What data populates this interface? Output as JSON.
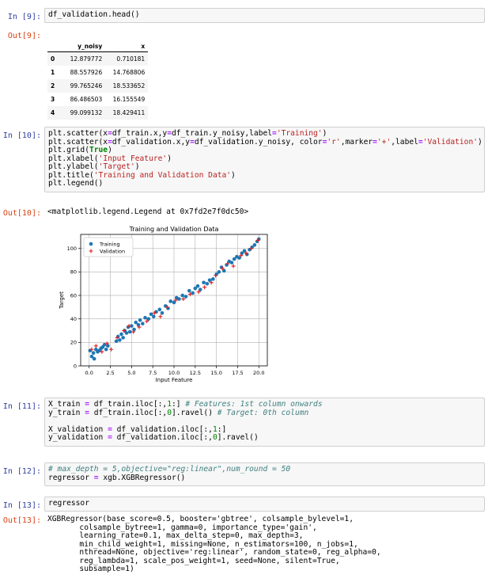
{
  "cells": [
    {
      "in_prompt": "In [9]:",
      "out_prompt": "Out[9]:",
      "code_lines": [
        "df_validation.head()"
      ]
    },
    {
      "in_prompt": "In [10]:",
      "out_prompt": "Out[10]:",
      "output_text": "<matplotlib.legend.Legend at 0x7fd2e7f0dc50>"
    },
    {
      "in_prompt": "In [11]:"
    },
    {
      "in_prompt": "In [12]:"
    },
    {
      "in_prompt": "In [13]:",
      "out_prompt": "Out[13]:"
    }
  ],
  "dataframe": {
    "columns": [
      "y_noisy",
      "x"
    ],
    "rows": [
      {
        "index": "0",
        "y_noisy": "12.879772",
        "x": "0.710181"
      },
      {
        "index": "1",
        "y_noisy": "88.557926",
        "x": "14.768806"
      },
      {
        "index": "2",
        "y_noisy": "99.765246",
        "x": "18.533652"
      },
      {
        "index": "3",
        "y_noisy": "86.486503",
        "x": "16.155549"
      },
      {
        "index": "4",
        "y_noisy": "99.099132",
        "x": "18.429411"
      }
    ]
  },
  "code10": [
    "plt.scatter(x=df_train.x,y=df_train.y_noisy,label='Training')",
    "plt.scatter(x=df_validation.x,y=df_validation.y_noisy, color='r',marker='+',label='Validation')",
    "plt.grid(True)",
    "plt.xlabel('Input Feature')",
    "plt.ylabel('Target')",
    "plt.title('Training and Validation Data')",
    "plt.legend()"
  ],
  "code11": [
    "X_train = df_train.iloc[:,1:] # Features: 1st column onwards",
    "y_train = df_train.iloc[:,0].ravel() # Target: 0th column",
    "",
    "X_validation = df_validation.iloc[:,1:]",
    "y_validation = df_validation.iloc[:,0].ravel()"
  ],
  "code12": [
    "# max_depth = 5,objective=\"reg:linear\",num_round = 50",
    "regressor = xgb.XGBRegressor()"
  ],
  "code13": [
    "regressor"
  ],
  "output13": "XGBRegressor(base_score=0.5, booster='gbtree', colsample_bylevel=1,\n       colsample_bytree=1, gamma=0, importance_type='gain',\n       learning_rate=0.1, max_delta_step=0, max_depth=3,\n       min_child_weight=1, missing=None, n_estimators=100, n_jobs=1,\n       nthread=None, objective='reg:linear', random_state=0, reg_alpha=0,\n       reg_lambda=1, scale_pos_weight=1, seed=None, silent=True,\n       subsample=1)",
  "chart_data": {
    "type": "scatter",
    "title": "Training and Validation Data",
    "xlabel": "Input Feature",
    "ylabel": "Target",
    "xlim": [
      -1,
      21
    ],
    "ylim": [
      0,
      112
    ],
    "xticks": [
      "0.0",
      "2.5",
      "5.0",
      "7.5",
      "10.0",
      "12.5",
      "15.0",
      "17.5",
      "20.0"
    ],
    "xtick_values": [
      0,
      2.5,
      5,
      7.5,
      10,
      12.5,
      15,
      17.5,
      20
    ],
    "yticks": [
      "0",
      "20",
      "40",
      "60",
      "80",
      "100"
    ],
    "ytick_values": [
      0,
      20,
      40,
      60,
      80,
      100
    ],
    "grid": true,
    "legend_position": "upper-left",
    "series": [
      {
        "name": "Training",
        "color": "#1f77b4",
        "marker": "o",
        "x": [
          0.1,
          0.3,
          0.5,
          0.6,
          0.8,
          1.0,
          1.2,
          1.4,
          1.6,
          1.8,
          2.0,
          2.2,
          3.2,
          3.4,
          3.6,
          3.8,
          4.0,
          4.2,
          4.4,
          4.6,
          4.8,
          5.0,
          5.3,
          5.5,
          5.8,
          6.0,
          6.3,
          6.6,
          7.0,
          7.3,
          7.6,
          7.9,
          8.3,
          8.6,
          9.0,
          9.3,
          9.6,
          10.0,
          10.3,
          10.6,
          11.0,
          11.4,
          11.8,
          12.2,
          12.5,
          12.8,
          13.1,
          13.5,
          13.9,
          14.2,
          14.6,
          15.0,
          15.3,
          15.6,
          15.9,
          16.2,
          16.5,
          16.8,
          17.1,
          17.4,
          17.7,
          18.0,
          18.3,
          18.6,
          18.9,
          19.2,
          19.5,
          19.8,
          20.0
        ],
        "y": [
          13,
          8,
          11,
          6,
          14,
          12,
          13,
          15,
          16,
          18,
          14,
          17,
          21,
          25,
          22,
          27,
          24,
          30,
          28,
          33,
          29,
          34,
          31,
          37,
          35,
          39,
          36,
          41,
          40,
          44,
          42,
          46,
          48,
          45,
          51,
          49,
          55,
          54,
          58,
          57,
          60,
          59,
          64,
          62,
          66,
          68,
          65,
          71,
          70,
          73,
          74,
          78,
          80,
          84,
          81,
          86,
          89,
          88,
          91,
          93,
          92,
          96,
          98,
          95,
          99,
          101,
          103,
          106,
          108
        ]
      },
      {
        "name": "Validation",
        "color": "#e01b1b",
        "marker": "+",
        "x": [
          0.3,
          0.8,
          1.5,
          2.1,
          2.6,
          3.3,
          4.1,
          4.7,
          5.2,
          5.9,
          6.8,
          7.7,
          8.4,
          9.2,
          10.2,
          11.1,
          11.9,
          12.9,
          13.6,
          14.4,
          14.9,
          15.7,
          16.3,
          17.0,
          17.9,
          18.5,
          19.1,
          19.9
        ],
        "y": [
          14,
          17,
          12,
          19,
          14,
          24,
          30,
          34,
          29,
          33,
          38,
          45,
          42,
          50,
          56,
          57,
          61,
          63,
          67,
          71,
          77,
          83,
          87,
          85,
          94,
          96,
          100,
          107
        ]
      }
    ]
  }
}
